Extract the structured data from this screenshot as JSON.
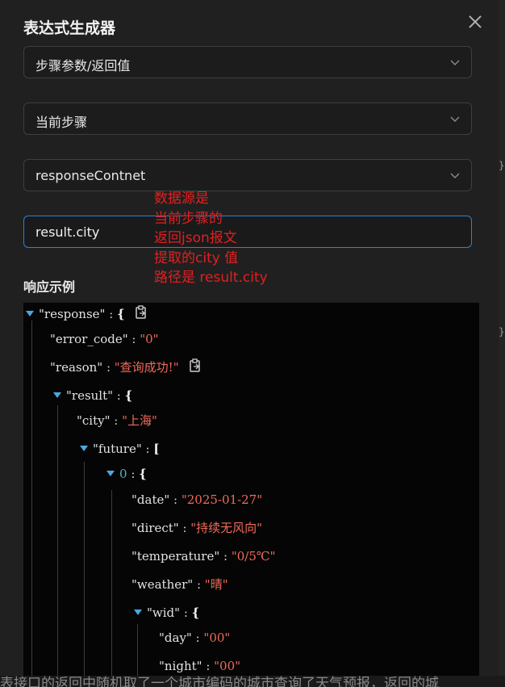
{
  "title": "表达式生成器",
  "selects": {
    "source_type": "步骤参数/返回值",
    "step": "当前步骤",
    "field": "responseContnet"
  },
  "expression_input": {
    "value": "result.city"
  },
  "annotation": {
    "lines": [
      "数据源是",
      "当前步骤的",
      "返回json报文",
      "提取的city 值",
      "路径是 result.city"
    ],
    "color": "#e02020"
  },
  "example_label": "响应示例",
  "json_view": {
    "response_key": "\"response\"",
    "error_code_key": "\"error_code\"",
    "error_code_val": "\"0\"",
    "reason_key": "\"reason\"",
    "reason_val": "\"查询成功!\"",
    "result_key": "\"result\"",
    "city_key": "\"city\"",
    "city_val": "\"上海\"",
    "future_key": "\"future\"",
    "index0": "0",
    "date_key": "\"date\"",
    "date_val": "\"2025-01-27\"",
    "direct_key": "\"direct\"",
    "direct_val": "\"持续无风向\"",
    "temperature_key": "\"temperature\"",
    "temperature_val": "\"0/5℃\"",
    "weather_key": "\"weather\"",
    "weather_val": "\"晴\"",
    "wid_key": "\"wid\"",
    "day_key": "\"day\"",
    "day_val": "\"00\"",
    "night_key": "\"night\"",
    "night_val": "\"00\""
  },
  "background_text": "表接口的返回中随机取了一个城市编码的城市查询了天气预报，返回的城"
}
